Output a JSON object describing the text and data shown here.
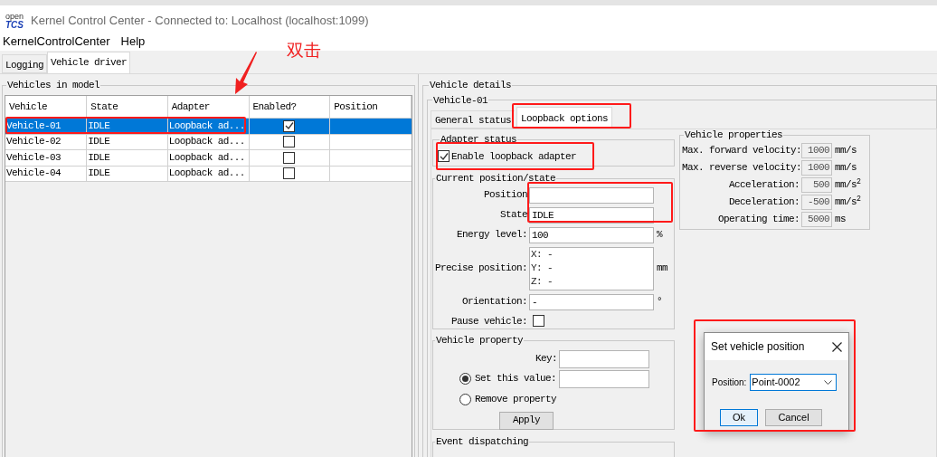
{
  "window": {
    "title": "Kernel Control Center - Connected to: Localhost (localhost:1099)",
    "logo_top": "open",
    "logo_bottom": "TCS"
  },
  "menu": [
    "KernelControlCenter",
    "Help"
  ],
  "tabs": [
    {
      "label": "Logging",
      "selected": false
    },
    {
      "label": "Vehicle driver",
      "selected": true
    }
  ],
  "vehicles_panel": {
    "title": "Vehicles in model",
    "columns": [
      "Vehicle",
      "State",
      "Adapter",
      "Enabled?",
      "Position"
    ],
    "rows": [
      {
        "vehicle": "Vehicle-01",
        "state": "IDLE",
        "adapter": "Loopback ad...",
        "enabled": true,
        "selected": true
      },
      {
        "vehicle": "Vehicle-02",
        "state": "IDLE",
        "adapter": "Loopback ad...",
        "enabled": false,
        "selected": false
      },
      {
        "vehicle": "Vehicle-03",
        "state": "IDLE",
        "adapter": "Loopback ad...",
        "enabled": false,
        "selected": false
      },
      {
        "vehicle": "Vehicle-04",
        "state": "IDLE",
        "adapter": "Loopback ad...",
        "enabled": false,
        "selected": false
      }
    ]
  },
  "details": {
    "title": "Vehicle details",
    "vehicle": "Vehicle-01",
    "tabs": [
      {
        "label": "General status",
        "selected": false
      },
      {
        "label": "Loopback options",
        "selected": true
      }
    ],
    "adapter_status": {
      "title": "Adapter status",
      "label": "Enable loopback adapter",
      "checked": true
    },
    "current_state": {
      "title": "Current position/state",
      "fields": [
        {
          "kind": "text",
          "label": "Position"
        },
        {
          "kind": "text",
          "label": "State",
          "value": "IDLE"
        },
        {
          "kind": "text",
          "label": "Energy level:",
          "value": "100",
          "unit": "%"
        },
        {
          "kind": "multiline",
          "label": "Precise position:",
          "lines": [
            "X: -",
            "Y: -",
            "Z: -"
          ],
          "unit": "mm"
        },
        {
          "kind": "text",
          "label": "Orientation:",
          "value": "-",
          "unit": "°"
        },
        {
          "kind": "checkbox",
          "label": "Pause vehicle:",
          "checked": false
        }
      ]
    },
    "vehicle_properties": {
      "title": "Vehicle properties",
      "rows": [
        {
          "label": "Max. forward velocity:",
          "value": "1000",
          "unit": "mm/s"
        },
        {
          "label": "Max. reverse velocity:",
          "value": "1000",
          "unit": "mm/s"
        },
        {
          "label": "Acceleration:",
          "value": "500",
          "unit": "mm/s$^{2}$"
        },
        {
          "label": "Deceleration:",
          "value": "-500",
          "unit": "mm/s$^{2}$"
        },
        {
          "label": "Operating time:",
          "value": "5000",
          "unit": "ms"
        }
      ]
    },
    "vehicle_property": {
      "title": "Vehicle property",
      "key_label": "Key:",
      "options": [
        {
          "label": "Set this value:",
          "selected": true
        },
        {
          "label": "Remove property",
          "selected": false
        }
      ],
      "apply": "Apply"
    },
    "event_dispatching": {
      "title": "Event dispatching"
    }
  },
  "dialog": {
    "title": "Set vehicle position",
    "position_label": "Position:",
    "position_value": "Point-0002",
    "buttons": [
      {
        "label": "Ok",
        "kind": "default"
      },
      {
        "label": "Cancel",
        "kind": "normal"
      }
    ]
  },
  "annotation": {
    "text": "双击"
  }
}
